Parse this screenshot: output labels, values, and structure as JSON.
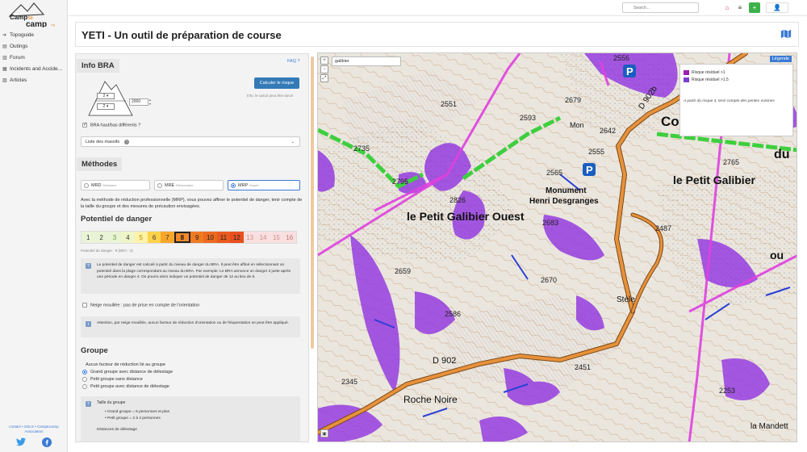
{
  "sidebar": {
    "logo_text": "Camp to Camp",
    "items": [
      {
        "label": "Topoguide",
        "icon": "arrow-right-icon"
      },
      {
        "label": "Outings",
        "icon": "outings-icon"
      },
      {
        "label": "Forum",
        "icon": "forum-icon"
      },
      {
        "label": "Incidents and Accide...",
        "icon": "incidents-icon"
      },
      {
        "label": "Articles",
        "icon": "articles-icon"
      }
    ],
    "footer_links": "contact • SOLS • Camptocamp Association",
    "twitter_icon": "twitter-icon",
    "facebook_icon": "facebook-icon"
  },
  "topbar": {
    "search_placeholder": "Search..."
  },
  "page": {
    "title": "YETI - Un outil de préparation de course"
  },
  "info_bra": {
    "title": "Info BRA",
    "faq": "FAQ ?",
    "calc_button": "Calculer le risque",
    "calc_hint": "Info: le calcul peut être lancé",
    "altitude": "2000",
    "bra_levels": [
      "2",
      "2"
    ],
    "checkbox_label": "BRA haut/bas différents ?",
    "massif_placeholder": "Liste des massifs"
  },
  "methodes": {
    "title": "Méthodes",
    "options": [
      {
        "label": "MRD",
        "sub": "Débutant",
        "active": false
      },
      {
        "label": "MRE",
        "sub": "Élémentaire",
        "active": false
      },
      {
        "label": "MRP",
        "sub": "Expert",
        "active": true
      }
    ],
    "description": "Avec la méthode de réduction professionnelle (MRP), vous pouvez affiner le potentiel de danger, tenir compte de la taille du groupe et des mesures de précaution envisagées."
  },
  "potentiel": {
    "title": "Potentiel de danger",
    "values": [
      "1",
      "2",
      "3",
      "4",
      "5",
      "6",
      "7",
      "8",
      "9",
      "10",
      "11",
      "12",
      "13",
      "14",
      "15",
      "16"
    ],
    "selected": "8",
    "caption": "Potentiel de danger : 8 (BRA : 3)",
    "info": "Le potentiel de danger est calculé à partir du niveau de danger du BRA. Il peut être affiné en sélectionnant un potentiel dans la plage correspondant au niveau du BRA. Par exemple: Le BRA annonce un danger 3 juste après une période en danger 4. On pourra alors indiquer un potentiel de danger de 12 au lieu de 8.",
    "wet_snow": "Neige mouillée : pas de prise en compte de l'orientation",
    "wet_info": "Attention, par neige mouillée, aucun facteur de réduction d'orientation ou de fréquentation ne peut être appliqué."
  },
  "groupe": {
    "title": "Groupe",
    "options": [
      {
        "label": "Aucun facteur de réduction lié au groupe",
        "on": false
      },
      {
        "label": "Grand groupe avec distance de délestage",
        "on": true
      },
      {
        "label": "Petit groupe sans distance",
        "on": false
      },
      {
        "label": "Petit groupe avec distance de délestage",
        "on": false
      }
    ],
    "box_title": "Taille du groupe",
    "bullets": [
      "Grand groupe = 5 personnes et plus",
      "Petit groupe = 2 à 4 personnes"
    ],
    "distances": "Distances de délestage"
  },
  "map": {
    "search_value": "galibier",
    "legend_btn": "Légende",
    "legend": [
      {
        "label": "Risque résiduel >1",
        "color": "#9b1fb0"
      },
      {
        "label": "Risque résiduel >1.5",
        "color": "#7a3fd0"
      }
    ],
    "legend_note": "A partir du risque 3, tenir compte des pentes voisines",
    "labels": {
      "col": "Col du Galibier",
      "petit": "le Petit Galibier",
      "ouest": "le Petit Galibier Ouest",
      "monument1": "Monument",
      "monument2": "Henri Desgranges",
      "roche": "Roche Noire",
      "stele": "Stèle",
      "mandette": "la Mandett",
      "road": "D 902",
      "road2": "D 902b",
      "mon": "Mon",
      "du": "du",
      "ou": "ou"
    },
    "elevations": [
      "2556",
      "2679",
      "2551",
      "2593",
      "2642",
      "2555",
      "2735",
      "2795",
      "2565",
      "2826",
      "2683",
      "2487",
      "2659",
      "2670",
      "2586",
      "2345",
      "2451",
      "2253",
      "2765"
    ]
  },
  "colors": {
    "accent": "#337ab7",
    "risk_purple": "#8a2be2",
    "trail_pink": "#e040e0",
    "road_orange": "#e8913a",
    "green_route": "#3ecf3e"
  }
}
